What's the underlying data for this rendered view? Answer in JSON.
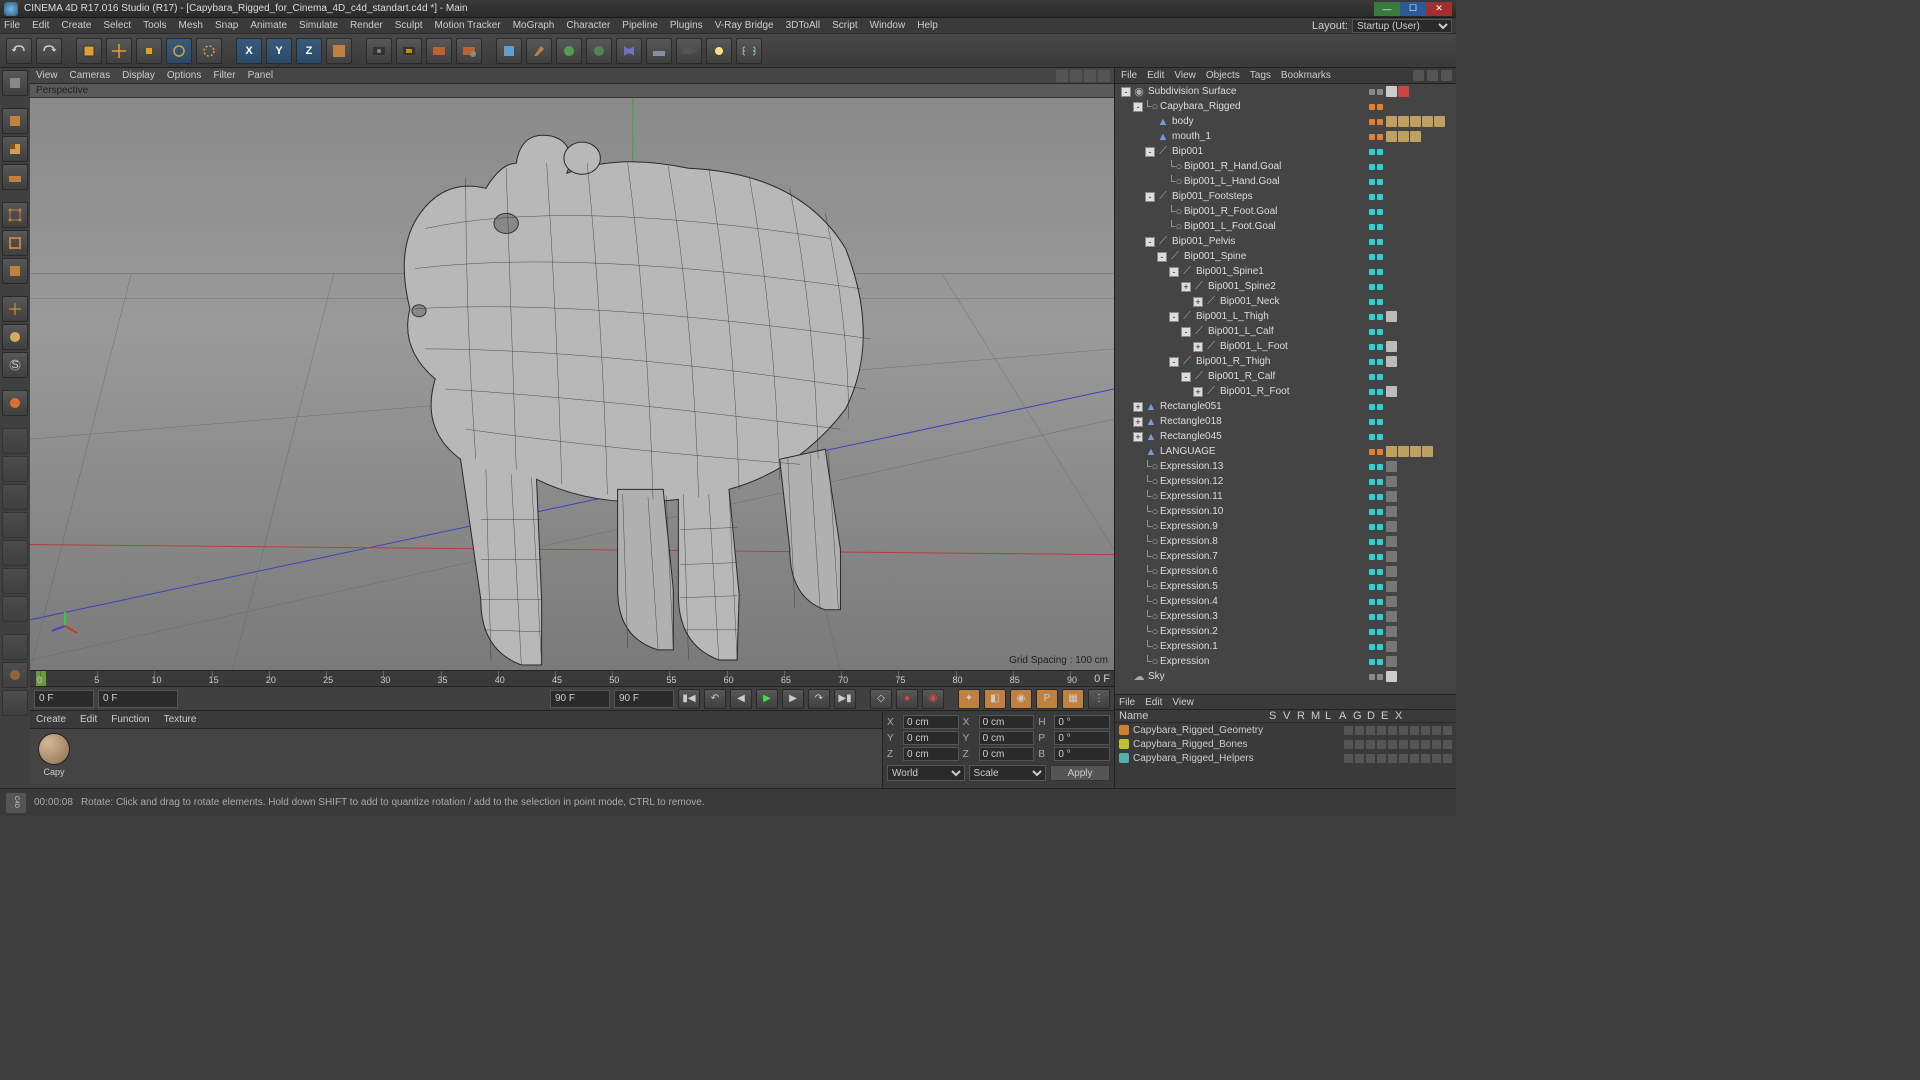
{
  "titlebar": {
    "text": "CINEMA 4D R17.016 Studio (R17) - [Capybara_Rigged_for_Cinema_4D_c4d_standart.c4d *] - Main"
  },
  "menubar": {
    "items": [
      "File",
      "Edit",
      "Create",
      "Select",
      "Tools",
      "Mesh",
      "Snap",
      "Animate",
      "Simulate",
      "Render",
      "Sculpt",
      "Motion Tracker",
      "MoGraph",
      "Character",
      "Pipeline",
      "Plugins",
      "V-Ray Bridge",
      "3DToAll",
      "Script",
      "Window",
      "Help"
    ],
    "layout_label": "Layout:",
    "layout_value": "Startup (User)"
  },
  "viewport_menus": [
    "View",
    "Cameras",
    "Display",
    "Options",
    "Filter",
    "Panel"
  ],
  "viewport": {
    "label": "Perspective",
    "grid_label": "Grid Spacing : 100 cm"
  },
  "timeline": {
    "start": 0,
    "end": 90,
    "step": 5,
    "cur_frame": "0 F",
    "start_field": "0 F",
    "end_field_left": "90 F",
    "end_field_right": "90 F",
    "right_label": "0 F"
  },
  "material_menus": [
    "Create",
    "Edit",
    "Function",
    "Texture"
  ],
  "materials": [
    {
      "name": "Capy"
    }
  ],
  "om_menus": [
    "File",
    "Edit",
    "View",
    "Objects",
    "Tags",
    "Bookmarks"
  ],
  "object_tree": [
    {
      "d": 0,
      "e": "-",
      "i": "subdiv",
      "n": "Subdivision Surface",
      "c": "gray",
      "t": [
        "chk",
        "x"
      ]
    },
    {
      "d": 1,
      "e": "-",
      "i": "null",
      "n": "Capybara_Rigged",
      "c": "orange"
    },
    {
      "d": 2,
      "e": "",
      "i": "poly",
      "n": "body",
      "c": "orange",
      "t": [
        "t1",
        "t2",
        "t3",
        "t4",
        "t5"
      ]
    },
    {
      "d": 2,
      "e": "",
      "i": "poly",
      "n": "mouth_1",
      "c": "orange",
      "t": [
        "t1",
        "t2",
        "t3"
      ]
    },
    {
      "d": 2,
      "e": "-",
      "i": "joint",
      "n": "Bip001",
      "c": "cyan"
    },
    {
      "d": 3,
      "e": "",
      "i": "null",
      "n": "Bip001_R_Hand.Goal",
      "c": "cyan"
    },
    {
      "d": 3,
      "e": "",
      "i": "null",
      "n": "Bip001_L_Hand.Goal",
      "c": "cyan"
    },
    {
      "d": 2,
      "e": "-",
      "i": "joint",
      "n": "Bip001_Footsteps",
      "c": "cyan"
    },
    {
      "d": 3,
      "e": "",
      "i": "null",
      "n": "Bip001_R_Foot.Goal",
      "c": "cyan"
    },
    {
      "d": 3,
      "e": "",
      "i": "null",
      "n": "Bip001_L_Foot.Goal",
      "c": "cyan"
    },
    {
      "d": 2,
      "e": "-",
      "i": "joint",
      "n": "Bip001_Pelvis",
      "c": "cyan"
    },
    {
      "d": 3,
      "e": "-",
      "i": "joint",
      "n": "Bip001_Spine",
      "c": "cyan"
    },
    {
      "d": 4,
      "e": "-",
      "i": "joint",
      "n": "Bip001_Spine1",
      "c": "cyan"
    },
    {
      "d": 5,
      "e": "+",
      "i": "joint",
      "n": "Bip001_Spine2",
      "c": "cyan"
    },
    {
      "d": 6,
      "e": "+",
      "i": "joint",
      "n": "Bip001_Neck",
      "c": "cyan"
    },
    {
      "d": 4,
      "e": "-",
      "i": "joint",
      "n": "Bip001_L_Thigh",
      "c": "cyan",
      "t": [
        "ik"
      ]
    },
    {
      "d": 5,
      "e": "-",
      "i": "joint",
      "n": "Bip001_L_Calf",
      "c": "cyan"
    },
    {
      "d": 6,
      "e": "+",
      "i": "joint",
      "n": "Bip001_L_Foot",
      "c": "cyan",
      "t": [
        "ik"
      ]
    },
    {
      "d": 4,
      "e": "-",
      "i": "joint",
      "n": "Bip001_R_Thigh",
      "c": "cyan",
      "t": [
        "ik"
      ]
    },
    {
      "d": 5,
      "e": "-",
      "i": "joint",
      "n": "Bip001_R_Calf",
      "c": "cyan"
    },
    {
      "d": 6,
      "e": "+",
      "i": "joint",
      "n": "Bip001_R_Foot",
      "c": "cyan",
      "t": [
        "ik"
      ]
    },
    {
      "d": 1,
      "e": "+",
      "i": "poly",
      "n": "Rectangle051",
      "c": "cyan"
    },
    {
      "d": 1,
      "e": "+",
      "i": "poly",
      "n": "Rectangle018",
      "c": "cyan"
    },
    {
      "d": 1,
      "e": "+",
      "i": "poly",
      "n": "Rectangle045",
      "c": "cyan"
    },
    {
      "d": 1,
      "e": "",
      "i": "poly",
      "n": "LANGUAGE",
      "c": "orange",
      "t": [
        "t1",
        "t2",
        "t3",
        "t4"
      ]
    },
    {
      "d": 1,
      "e": "",
      "i": "null",
      "n": "Expression.13",
      "c": "cyan",
      "t": [
        "xp"
      ]
    },
    {
      "d": 1,
      "e": "",
      "i": "null",
      "n": "Expression.12",
      "c": "cyan",
      "t": [
        "xp"
      ]
    },
    {
      "d": 1,
      "e": "",
      "i": "null",
      "n": "Expression.11",
      "c": "cyan",
      "t": [
        "xp"
      ]
    },
    {
      "d": 1,
      "e": "",
      "i": "null",
      "n": "Expression.10",
      "c": "cyan",
      "t": [
        "xp"
      ]
    },
    {
      "d": 1,
      "e": "",
      "i": "null",
      "n": "Expression.9",
      "c": "cyan",
      "t": [
        "xp"
      ]
    },
    {
      "d": 1,
      "e": "",
      "i": "null",
      "n": "Expression.8",
      "c": "cyan",
      "t": [
        "xp"
      ]
    },
    {
      "d": 1,
      "e": "",
      "i": "null",
      "n": "Expression.7",
      "c": "cyan",
      "t": [
        "xp"
      ]
    },
    {
      "d": 1,
      "e": "",
      "i": "null",
      "n": "Expression.6",
      "c": "cyan",
      "t": [
        "xp"
      ]
    },
    {
      "d": 1,
      "e": "",
      "i": "null",
      "n": "Expression.5",
      "c": "cyan",
      "t": [
        "xp"
      ]
    },
    {
      "d": 1,
      "e": "",
      "i": "null",
      "n": "Expression.4",
      "c": "cyan",
      "t": [
        "xp"
      ]
    },
    {
      "d": 1,
      "e": "",
      "i": "null",
      "n": "Expression.3",
      "c": "cyan",
      "t": [
        "xp"
      ]
    },
    {
      "d": 1,
      "e": "",
      "i": "null",
      "n": "Expression.2",
      "c": "cyan",
      "t": [
        "xp"
      ]
    },
    {
      "d": 1,
      "e": "",
      "i": "null",
      "n": "Expression.1",
      "c": "cyan",
      "t": [
        "xp"
      ]
    },
    {
      "d": 1,
      "e": "",
      "i": "null",
      "n": "Expression",
      "c": "cyan",
      "t": [
        "xp"
      ]
    },
    {
      "d": 0,
      "e": "",
      "i": "sky",
      "n": "Sky",
      "c": "gray",
      "t": [
        "chk"
      ]
    }
  ],
  "coords": {
    "rows": [
      {
        "a": "X",
        "av": "0 cm",
        "b": "X",
        "bv": "0 cm",
        "c": "H",
        "cv": "0 °"
      },
      {
        "a": "Y",
        "av": "0 cm",
        "b": "Y",
        "bv": "0 cm",
        "c": "P",
        "cv": "0 °"
      },
      {
        "a": "Z",
        "av": "0 cm",
        "b": "Z",
        "bv": "0 cm",
        "c": "B",
        "cv": "0 °"
      }
    ],
    "mode1": "World",
    "mode2": "Scale",
    "apply": "Apply"
  },
  "layer_menus": [
    "File",
    "Edit",
    "View"
  ],
  "layer_cols": [
    "Name",
    "S",
    "V",
    "R",
    "M",
    "L",
    "A",
    "G",
    "D",
    "E",
    "X"
  ],
  "layers": [
    {
      "color": "#d08030",
      "name": "Capybara_Rigged_Geometry"
    },
    {
      "color": "#c0c030",
      "name": "Capybara_Rigged_Bones"
    },
    {
      "color": "#50b0b0",
      "name": "Capybara_Rigged_Helpers"
    }
  ],
  "status": {
    "time": "00:00:08",
    "hint": "Rotate: Click and drag to rotate elements. Hold down SHIFT to add to quantize rotation / add to the selection in point mode, CTRL to remove."
  }
}
